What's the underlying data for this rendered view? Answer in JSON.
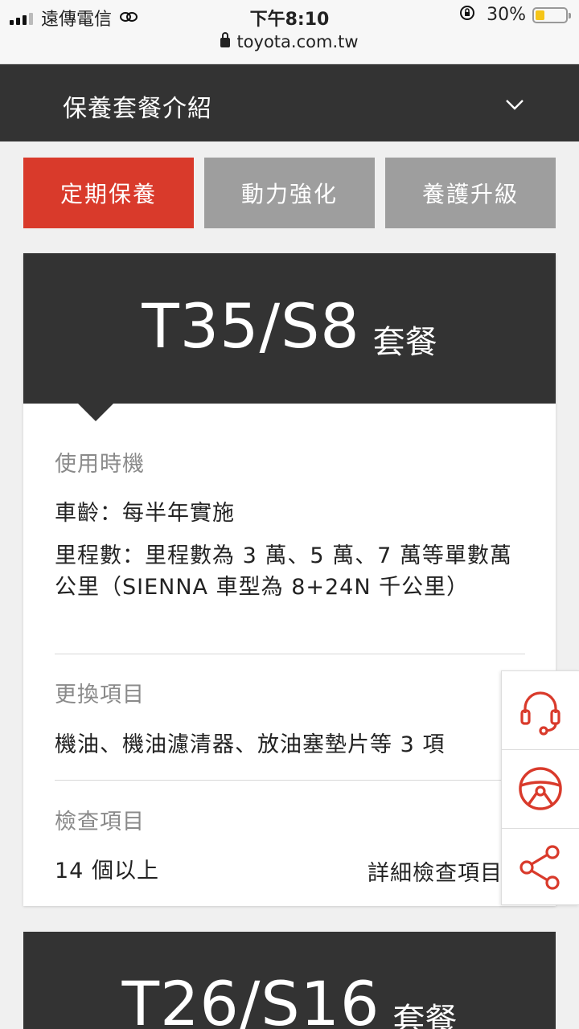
{
  "status_bar": {
    "carrier": "遠傳電信",
    "time": "下午8:10",
    "url": "toyota.com.tw",
    "battery": "30%",
    "battery_level": 0.3,
    "battery_color": "#f5c518"
  },
  "header": {
    "title": "保養套餐介紹",
    "chevron_icon": "chevron-down-icon"
  },
  "tabs": [
    {
      "label": "定期保養",
      "active": true
    },
    {
      "label": "動力強化",
      "active": false
    },
    {
      "label": "養護升級",
      "active": false
    }
  ],
  "colors": {
    "accent": "#d93a2b",
    "dark": "#333333",
    "inactive_tab": "#9e9e9e"
  },
  "package1": {
    "code": "T35/S8",
    "suffix": "套餐",
    "timing_label": "使用時機",
    "timing_line1": "車齡：每半年實施",
    "timing_line2": "里程數：里程數為 3 萬、5 萬、7 萬等單數萬公里（SIENNA 車型為 8+24N 千公里）",
    "replace_label": "更換項目",
    "replace_text": "機油、機油濾清器、放油塞墊片等 3 項",
    "check_label": "檢查項目",
    "check_count": "14 個以上",
    "detail_link": "詳細檢查項目"
  },
  "package2": {
    "code": "T26/S16",
    "suffix": "套餐"
  },
  "float_panel": {
    "icons": [
      "headset-icon",
      "steering-wheel-icon",
      "share-icon"
    ]
  }
}
